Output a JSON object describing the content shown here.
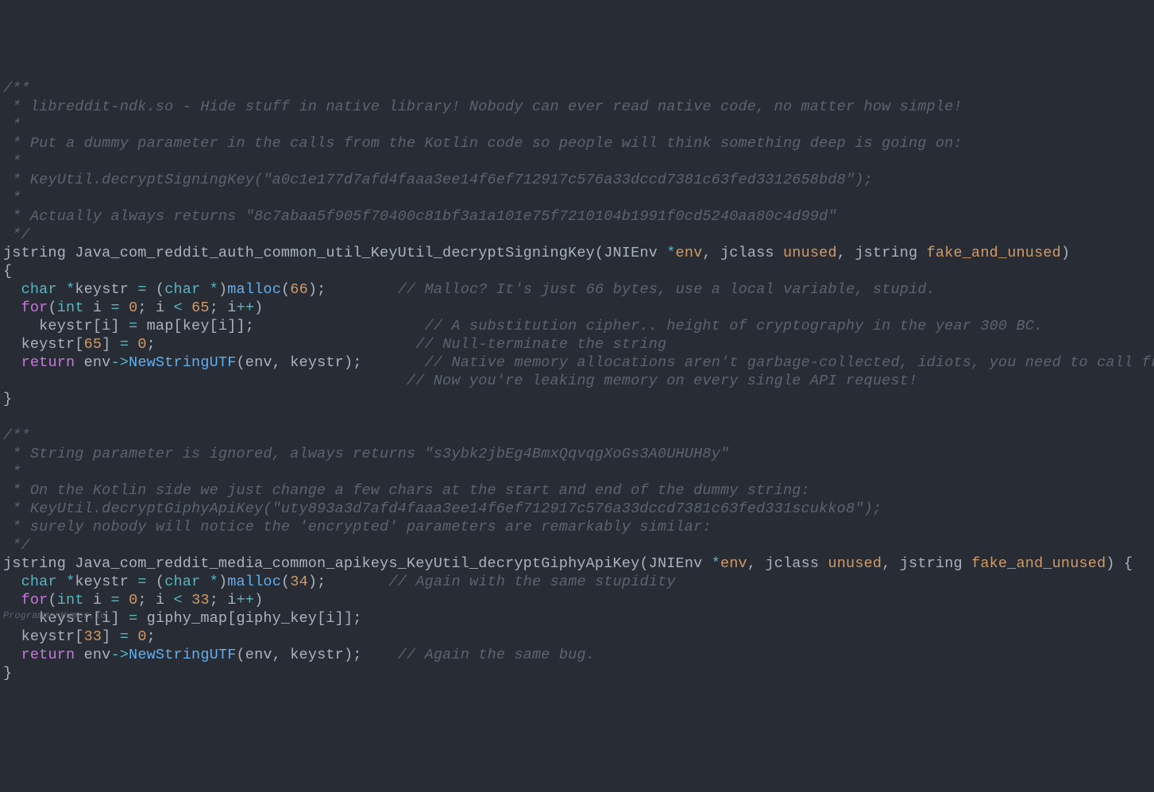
{
  "watermark": "ProgrammerHumor.io",
  "tokens": [
    [
      [
        "cm",
        "/**"
      ]
    ],
    [
      [
        "cm",
        " * libreddit-ndk.so - Hide stuff in native library! Nobody can ever read native code, no matter how simple!"
      ]
    ],
    [
      [
        "cm",
        " *"
      ]
    ],
    [
      [
        "cm",
        " * Put a dummy parameter in the calls from the Kotlin code so people will think something deep is going on:"
      ]
    ],
    [
      [
        "cm",
        " *"
      ]
    ],
    [
      [
        "cm",
        " * KeyUtil.decryptSigningKey(\"a0c1e177d7afd4faaa3ee14f6ef712917c576a33dccd7381c63fed3312658bd8\");"
      ]
    ],
    [
      [
        "cm",
        " *"
      ]
    ],
    [
      [
        "cm",
        " * Actually always returns \"8c7abaa5f905f70400c81bf3a1a101e75f7210104b1991f0cd5240aa80c4d99d\""
      ]
    ],
    [
      [
        "cm",
        " */"
      ]
    ],
    [
      [
        "id",
        "jstring "
      ],
      [
        "fn",
        "Java_com_reddit_auth_common_util_KeyUtil_decryptSigningKey"
      ],
      [
        "pun",
        "("
      ],
      [
        "id",
        "JNIEnv "
      ],
      [
        "opc",
        "*"
      ],
      [
        "prm",
        "env"
      ],
      [
        "pun",
        ", "
      ],
      [
        "id",
        "jclass "
      ],
      [
        "prm",
        "unused"
      ],
      [
        "pun",
        ", "
      ],
      [
        "id",
        "jstring "
      ],
      [
        "prm",
        "fake_and_unused"
      ],
      [
        "pun",
        ")"
      ]
    ],
    [
      [
        "pun",
        "{"
      ]
    ],
    [
      [
        "pun",
        "  "
      ],
      [
        "tyc",
        "char"
      ],
      [
        "pun",
        " "
      ],
      [
        "opc",
        "*"
      ],
      [
        "id",
        "keystr "
      ],
      [
        "opc",
        "="
      ],
      [
        "pun",
        " ("
      ],
      [
        "tyc",
        "char"
      ],
      [
        "pun",
        " "
      ],
      [
        "opc",
        "*"
      ],
      [
        "pun",
        ")"
      ],
      [
        "call",
        "malloc"
      ],
      [
        "pun",
        "("
      ],
      [
        "num",
        "66"
      ],
      [
        "pun",
        ");        "
      ],
      [
        "cm",
        "// Malloc? It's just 66 bytes, use a local variable, stupid."
      ]
    ],
    [
      [
        "pun",
        "  "
      ],
      [
        "kw",
        "for"
      ],
      [
        "pun",
        "("
      ],
      [
        "tyc",
        "int"
      ],
      [
        "pun",
        " i "
      ],
      [
        "opc",
        "="
      ],
      [
        "pun",
        " "
      ],
      [
        "num",
        "0"
      ],
      [
        "pun",
        "; i "
      ],
      [
        "opc",
        "<"
      ],
      [
        "pun",
        " "
      ],
      [
        "num",
        "65"
      ],
      [
        "pun",
        "; i"
      ],
      [
        "opc",
        "++"
      ],
      [
        "pun",
        ")"
      ]
    ],
    [
      [
        "pun",
        "    keystr["
      ],
      [
        "id",
        "i"
      ],
      [
        "pun",
        "] "
      ],
      [
        "opc",
        "="
      ],
      [
        "pun",
        " map[key["
      ],
      [
        "id",
        "i"
      ],
      [
        "pun",
        "]];                   "
      ],
      [
        "cm",
        "// A substitution cipher.. height of cryptography in the year 300 BC."
      ]
    ],
    [
      [
        "pun",
        "  keystr["
      ],
      [
        "num",
        "65"
      ],
      [
        "pun",
        "] "
      ],
      [
        "opc",
        "="
      ],
      [
        "pun",
        " "
      ],
      [
        "num",
        "0"
      ],
      [
        "pun",
        ";                             "
      ],
      [
        "cm",
        "// Null-terminate the string"
      ]
    ],
    [
      [
        "pun",
        "  "
      ],
      [
        "kw",
        "return"
      ],
      [
        "pun",
        " env"
      ],
      [
        "opc",
        "->"
      ],
      [
        "call",
        "NewStringUTF"
      ],
      [
        "pun",
        "("
      ],
      [
        "id",
        "env"
      ],
      [
        "pun",
        ", "
      ],
      [
        "id",
        "keystr"
      ],
      [
        "pun",
        ");       "
      ],
      [
        "cm",
        "// Native memory allocations aren't garbage-collected, idiots, you need to call free()"
      ]
    ],
    [
      [
        "pun",
        "                                             "
      ],
      [
        "cm",
        "// Now you're leaking memory on every single API request!"
      ]
    ],
    [
      [
        "pun",
        "}"
      ]
    ],
    [],
    [
      [
        "cm",
        "/**"
      ]
    ],
    [
      [
        "cm",
        " * String parameter is ignored, always returns \"s3ybk2jbEg4BmxQqvqgXoGs3A0UHUH8y\""
      ]
    ],
    [
      [
        "cm",
        " *"
      ]
    ],
    [
      [
        "cm",
        " * On the Kotlin side we just change a few chars at the start and end of the dummy string:"
      ]
    ],
    [
      [
        "cm",
        " * KeyUtil.decryptGiphyApiKey(\"uty893a3d7afd4faaa3ee14f6ef712917c576a33dccd7381c63fed331scukko8\");"
      ]
    ],
    [
      [
        "cm",
        " * surely nobody will notice the 'encrypted' parameters are remarkably similar:"
      ]
    ],
    [
      [
        "cm",
        " */"
      ]
    ],
    [
      [
        "id",
        "jstring "
      ],
      [
        "fn",
        "Java_com_reddit_media_common_apikeys_KeyUtil_decryptGiphyApiKey"
      ],
      [
        "pun",
        "("
      ],
      [
        "id",
        "JNIEnv "
      ],
      [
        "opc",
        "*"
      ],
      [
        "prm",
        "env"
      ],
      [
        "pun",
        ", "
      ],
      [
        "id",
        "jclass "
      ],
      [
        "prm",
        "unused"
      ],
      [
        "pun",
        ", "
      ],
      [
        "id",
        "jstring "
      ],
      [
        "prm",
        "fake_and_unused"
      ],
      [
        "pun",
        ") {"
      ]
    ],
    [
      [
        "pun",
        "  "
      ],
      [
        "tyc",
        "char"
      ],
      [
        "pun",
        " "
      ],
      [
        "opc",
        "*"
      ],
      [
        "id",
        "keystr "
      ],
      [
        "opc",
        "="
      ],
      [
        "pun",
        " ("
      ],
      [
        "tyc",
        "char"
      ],
      [
        "pun",
        " "
      ],
      [
        "opc",
        "*"
      ],
      [
        "pun",
        ")"
      ],
      [
        "call",
        "malloc"
      ],
      [
        "pun",
        "("
      ],
      [
        "num",
        "34"
      ],
      [
        "pun",
        ");       "
      ],
      [
        "cm",
        "// Again with the same stupidity"
      ]
    ],
    [
      [
        "pun",
        "  "
      ],
      [
        "kw",
        "for"
      ],
      [
        "pun",
        "("
      ],
      [
        "tyc",
        "int"
      ],
      [
        "pun",
        " i "
      ],
      [
        "opc",
        "="
      ],
      [
        "pun",
        " "
      ],
      [
        "num",
        "0"
      ],
      [
        "pun",
        "; i "
      ],
      [
        "opc",
        "<"
      ],
      [
        "pun",
        " "
      ],
      [
        "num",
        "33"
      ],
      [
        "pun",
        "; i"
      ],
      [
        "opc",
        "++"
      ],
      [
        "pun",
        ")"
      ]
    ],
    [
      [
        "pun",
        "    keystr["
      ],
      [
        "id",
        "i"
      ],
      [
        "pun",
        "] "
      ],
      [
        "opc",
        "="
      ],
      [
        "pun",
        " giphy_map[giphy_key["
      ],
      [
        "id",
        "i"
      ],
      [
        "pun",
        "]];"
      ]
    ],
    [
      [
        "pun",
        "  keystr["
      ],
      [
        "num",
        "33"
      ],
      [
        "pun",
        "] "
      ],
      [
        "opc",
        "="
      ],
      [
        "pun",
        " "
      ],
      [
        "num",
        "0"
      ],
      [
        "pun",
        ";"
      ]
    ],
    [
      [
        "pun",
        "  "
      ],
      [
        "kw",
        "return"
      ],
      [
        "pun",
        " env"
      ],
      [
        "opc",
        "->"
      ],
      [
        "call",
        "NewStringUTF"
      ],
      [
        "pun",
        "("
      ],
      [
        "id",
        "env"
      ],
      [
        "pun",
        ", "
      ],
      [
        "id",
        "keystr"
      ],
      [
        "pun",
        ");    "
      ],
      [
        "cm",
        "// Again the same bug."
      ]
    ],
    [
      [
        "pun",
        "}"
      ]
    ]
  ]
}
